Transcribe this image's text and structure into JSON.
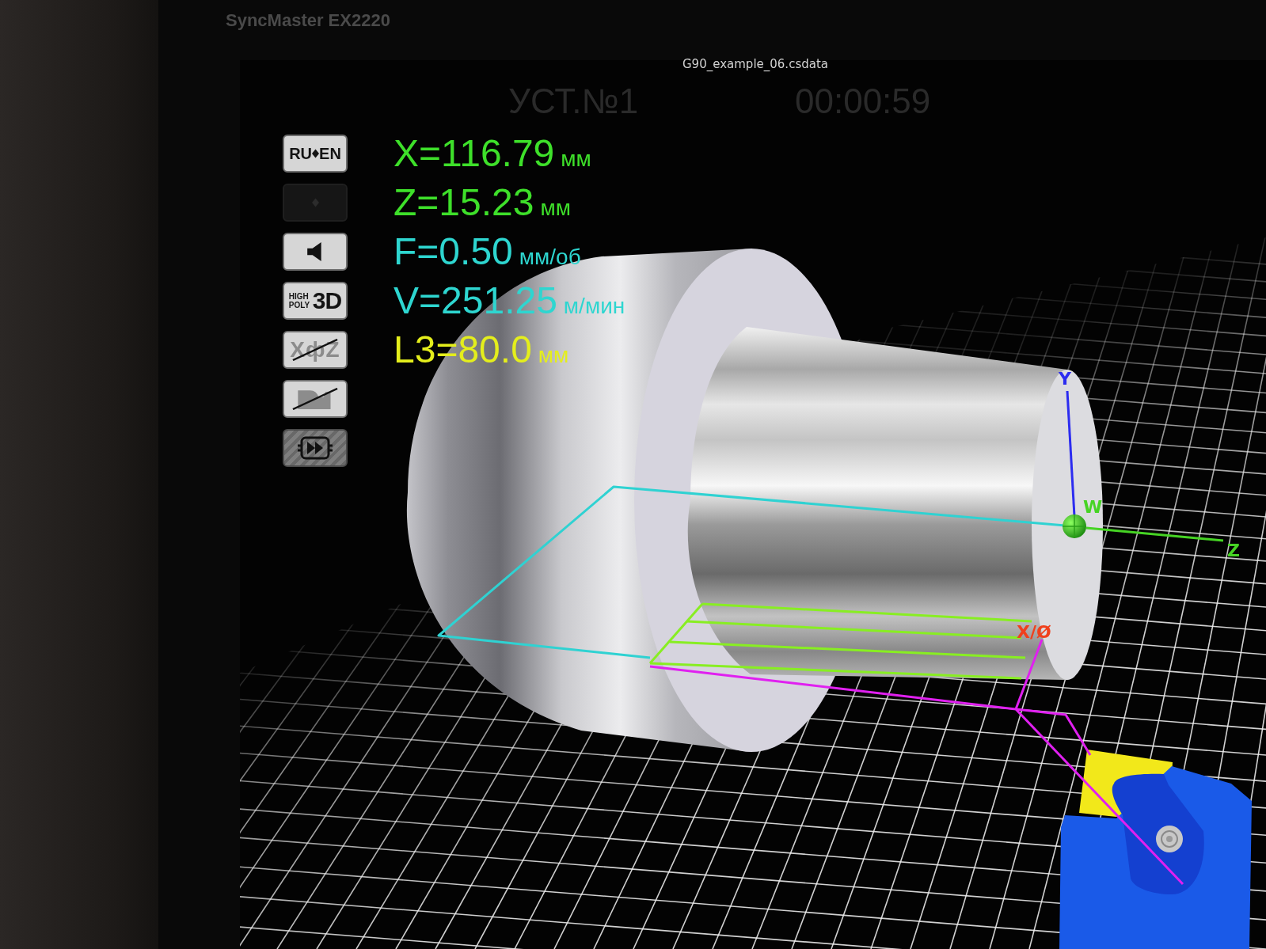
{
  "monitor": {
    "bezel_label": "SyncMaster EX2220"
  },
  "window": {
    "title": "G90_example_06.csdata"
  },
  "status": {
    "setup": "УСТ.№1",
    "timer": "00:00:59"
  },
  "buttons": [
    {
      "kind": "swap",
      "left": "RU",
      "right": "EN",
      "disabled": false,
      "on": true
    },
    {
      "kind": "swap",
      "disabled": true,
      "on": true
    },
    {
      "kind": "sound",
      "disabled": false,
      "on": true
    },
    {
      "kind": "quality",
      "small_lines": [
        "HIGH",
        "POLY"
      ],
      "big": "3D",
      "disabled": false,
      "on": true
    },
    {
      "kind": "axis",
      "label": "XфZ",
      "disabled": false,
      "on": false
    },
    {
      "kind": "profile",
      "disabled": false,
      "on": false
    },
    {
      "kind": "fast-forward",
      "disabled": false,
      "on": true
    }
  ],
  "readouts": [
    {
      "label": "X=116.79",
      "unit": "мм",
      "color": "#3ee02a"
    },
    {
      "label": "Z=15.23",
      "unit": "мм",
      "color": "#3ee02a"
    },
    {
      "label": "F=0.50",
      "unit": "мм/об",
      "color": "#2ed6d0"
    },
    {
      "label": "V=251.25",
      "unit": "м/мин",
      "color": "#2ed6d0"
    },
    {
      "label": "L3=80.0",
      "unit": "мм",
      "color": "#e4ee1c"
    }
  ],
  "viewport": {
    "axis_labels": [
      {
        "kind": "y",
        "label": "Y",
        "color": "#2c2cf0"
      },
      {
        "kind": "w",
        "label": "W",
        "color": "#46d424"
      },
      {
        "kind": "z",
        "label": "Z",
        "color": "#46d424"
      },
      {
        "kind": "x",
        "label": "X/Ø",
        "color": "#f0401c"
      }
    ]
  }
}
